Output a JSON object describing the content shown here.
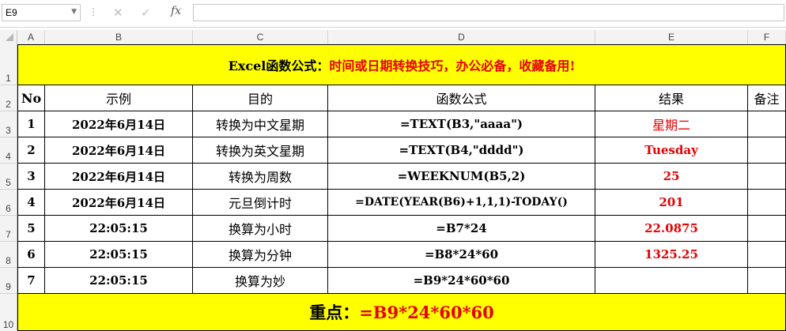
{
  "formula_bar": {
    "name_box": "E9",
    "dots": "⋮",
    "cancel_icon": "✕",
    "enter_icon": "✓",
    "fx_label": "fx",
    "formula_value": ""
  },
  "columns": [
    "A",
    "B",
    "C",
    "D",
    "E",
    "F"
  ],
  "rows": [
    "1",
    "2",
    "3",
    "4",
    "5",
    "6",
    "7",
    "8",
    "9",
    "10"
  ],
  "title": {
    "prefix": "Excel函数公式：",
    "highlight": "时间或日期转换技巧，办公必备，收藏备用!"
  },
  "table": {
    "headers": [
      "No",
      "示例",
      "目的",
      "函数公式",
      "结果",
      "备注"
    ],
    "rows": [
      {
        "no": "1",
        "example": "2022年6月14日",
        "purpose": "转换为中文星期",
        "formula": "=TEXT(B3,\"aaaa\")",
        "result": "星期二",
        "note": ""
      },
      {
        "no": "2",
        "example": "2022年6月14日",
        "purpose": "转换为英文星期",
        "formula": "=TEXT(B4,\"dddd\")",
        "result": "Tuesday",
        "note": ""
      },
      {
        "no": "3",
        "example": "2022年6月14日",
        "purpose": "转换为周数",
        "formula": "=WEEKNUM(B5,2)",
        "result": "25",
        "note": ""
      },
      {
        "no": "4",
        "example": "2022年6月14日",
        "purpose": "元旦倒计时",
        "formula": "=DATE(YEAR(B6)+1,1,1)-TODAY()",
        "result": "201",
        "note": ""
      },
      {
        "no": "5",
        "example": "22:05:15",
        "purpose": "换算为小时",
        "formula": "=B7*24",
        "result": "22.0875",
        "note": ""
      },
      {
        "no": "6",
        "example": "22:05:15",
        "purpose": "换算为分钟",
        "formula": "=B8*24*60",
        "result": "1325.25",
        "note": ""
      },
      {
        "no": "7",
        "example": "22:05:15",
        "purpose": "换算为妙",
        "formula": "=B9*24*60*60",
        "result": "",
        "note": ""
      }
    ]
  },
  "footer": {
    "label": "重点：",
    "value": "=B9*24*60*60"
  },
  "colors": {
    "highlight_bg": "#ffff00",
    "accent_red": "#e60000"
  }
}
